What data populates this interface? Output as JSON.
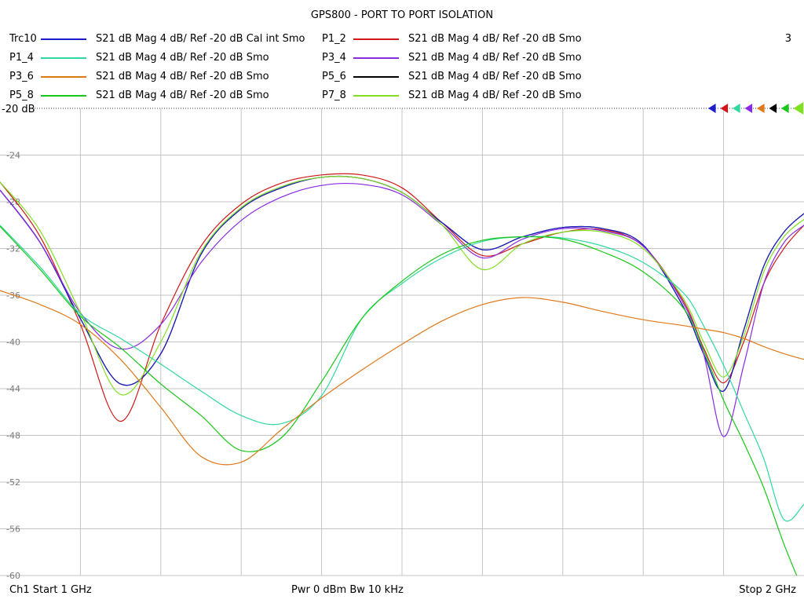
{
  "title": "GPS800 - PORT TO PORT ISOLATION",
  "channel_number": "3",
  "legend": [
    {
      "name": "Trc10",
      "desc": "S21  dB Mag  4 dB/ Ref -20 dB  Cal int Smo",
      "color": "#1c1cc8"
    },
    {
      "name": "P1_2",
      "desc": "S21  dB Mag  4 dB/ Ref -20 dB  Smo",
      "color": "#d01818"
    },
    {
      "name": "P1_4",
      "desc": "S21  dB Mag  4 dB/ Ref -20 dB  Smo",
      "color": "#30d8a0"
    },
    {
      "name": "P3_4",
      "desc": "S21  dB Mag  4 dB/ Ref -20 dB  Smo",
      "color": "#8a2be2"
    },
    {
      "name": "P3_6",
      "desc": "S21  dB Mag  4 dB/ Ref -20 dB  Smo",
      "color": "#e07818"
    },
    {
      "name": "P5_6",
      "desc": "S21  dB Mag  4 dB/ Ref -20 dB  Smo",
      "color": "#000000"
    },
    {
      "name": "P5_8",
      "desc": "S21  dB Mag  4 dB/ Ref -20 dB  Smo",
      "color": "#18c818"
    },
    {
      "name": "P7_8",
      "desc": "S21  dB Mag  4 dB/ Ref -20 dB  Smo",
      "color": "#80e020"
    }
  ],
  "footer": {
    "start": "Ch1  Start  1 GHz",
    "power": "Pwr  0 dBm  Bw  10 kHz",
    "stop": "Stop  2 GHz"
  },
  "chart_data": {
    "type": "line",
    "title": "GPS800 - PORT TO PORT ISOLATION",
    "xlabel": "",
    "ylabel": "",
    "xlim": [
      1.0,
      2.0
    ],
    "ylim": [
      -60,
      -20
    ],
    "x_unit": "GHz",
    "ref_label": "-20 dB",
    "y_ticks": [
      -24,
      -28,
      -32,
      -36,
      -40,
      -44,
      -48,
      -52,
      -56,
      -60
    ],
    "y_tick_labels": [
      "-24",
      "-28",
      "-32",
      "-36",
      "-40",
      "-44",
      "-48",
      "-52",
      "-56",
      "-60"
    ],
    "grid": true,
    "x": [
      1.0,
      1.05,
      1.1,
      1.15,
      1.2,
      1.25,
      1.3,
      1.35,
      1.4,
      1.45,
      1.5,
      1.55,
      1.6,
      1.65,
      1.7,
      1.75,
      1.8,
      1.85,
      1.875,
      1.9,
      1.925,
      1.95,
      1.975,
      2.0
    ],
    "series": [
      {
        "name": "P1_2",
        "color": "#d01818",
        "values": [
          -26.3,
          -31.0,
          -38.5,
          -46.8,
          -38.5,
          -31.8,
          -28.2,
          -26.4,
          -25.7,
          -25.7,
          -26.8,
          -29.8,
          -32.6,
          -31.6,
          -30.6,
          -30.4,
          -31.8,
          -36.5,
          -40.5,
          -43.5,
          -40.0,
          -35.0,
          -32.0,
          -30.0
        ]
      },
      {
        "name": "P5_6",
        "color": "#000000",
        "values": [
          -27.0,
          -31.5,
          -38.0,
          -43.6,
          -41.0,
          -32.5,
          -28.6,
          -26.8,
          -25.9,
          -26.0,
          -27.2,
          -29.8,
          -32.1,
          -31.0,
          -30.2,
          -30.3,
          -31.7,
          -37.0,
          -41.0,
          -44.2,
          -39.0,
          -33.5,
          -30.6,
          -29.0
        ]
      },
      {
        "name": "Trc10",
        "color": "#1c1cc8",
        "values": [
          -27.0,
          -31.5,
          -38.0,
          -43.6,
          -41.0,
          -32.5,
          -28.6,
          -26.8,
          -25.9,
          -26.0,
          -27.2,
          -29.8,
          -32.1,
          -31.0,
          -30.2,
          -30.3,
          -31.7,
          -37.0,
          -41.0,
          -44.2,
          -39.0,
          -33.5,
          -30.6,
          -29.0
        ]
      },
      {
        "name": "P3_4",
        "color": "#8a2be2",
        "values": [
          -27.0,
          -31.5,
          -37.5,
          -40.6,
          -38.5,
          -33.2,
          -29.6,
          -27.6,
          -26.6,
          -26.5,
          -27.4,
          -30.0,
          -32.8,
          -31.2,
          -30.3,
          -30.5,
          -31.8,
          -36.7,
          -41.0,
          -48.1,
          -42.0,
          -35.0,
          -31.5,
          -30.0
        ]
      },
      {
        "name": "P7_8",
        "color": "#80e020",
        "values": [
          -26.3,
          -30.5,
          -37.5,
          -44.5,
          -40.0,
          -32.3,
          -28.5,
          -26.7,
          -25.9,
          -26.0,
          -27.2,
          -30.0,
          -33.8,
          -31.6,
          -30.6,
          -30.6,
          -32.0,
          -36.3,
          -40.0,
          -43.0,
          -39.5,
          -34.0,
          -31.0,
          -29.5
        ]
      },
      {
        "name": "P1_4",
        "color": "#30d8a0",
        "values": [
          -30.0,
          -33.6,
          -37.6,
          -39.7,
          -41.9,
          -44.2,
          -46.3,
          -47.0,
          -44.6,
          -38.0,
          -35.0,
          -32.8,
          -31.4,
          -31.0,
          -31.1,
          -31.8,
          -33.2,
          -35.8,
          -38.6,
          -42.0,
          -46.0,
          -50.0,
          -55.2,
          -53.9
        ]
      },
      {
        "name": "P5_8",
        "color": "#18c818",
        "values": [
          -30.1,
          -33.8,
          -37.8,
          -40.5,
          -43.6,
          -46.3,
          -49.3,
          -48.2,
          -43.4,
          -38.0,
          -34.8,
          -32.5,
          -31.3,
          -31.0,
          -31.2,
          -32.3,
          -34.0,
          -37.1,
          -40.7,
          -45.0,
          -48.6,
          -52.5,
          -57.3,
          -61.5
        ]
      },
      {
        "name": "P3_6",
        "color": "#e07818",
        "values": [
          -35.6,
          -36.8,
          -38.5,
          -41.5,
          -45.6,
          -49.8,
          -50.3,
          -47.5,
          -44.8,
          -42.4,
          -40.2,
          -38.2,
          -36.8,
          -36.2,
          -36.6,
          -37.4,
          -38.1,
          -38.6,
          -38.9,
          -39.2,
          -39.7,
          -40.4,
          -41.0,
          -41.5
        ]
      }
    ]
  }
}
